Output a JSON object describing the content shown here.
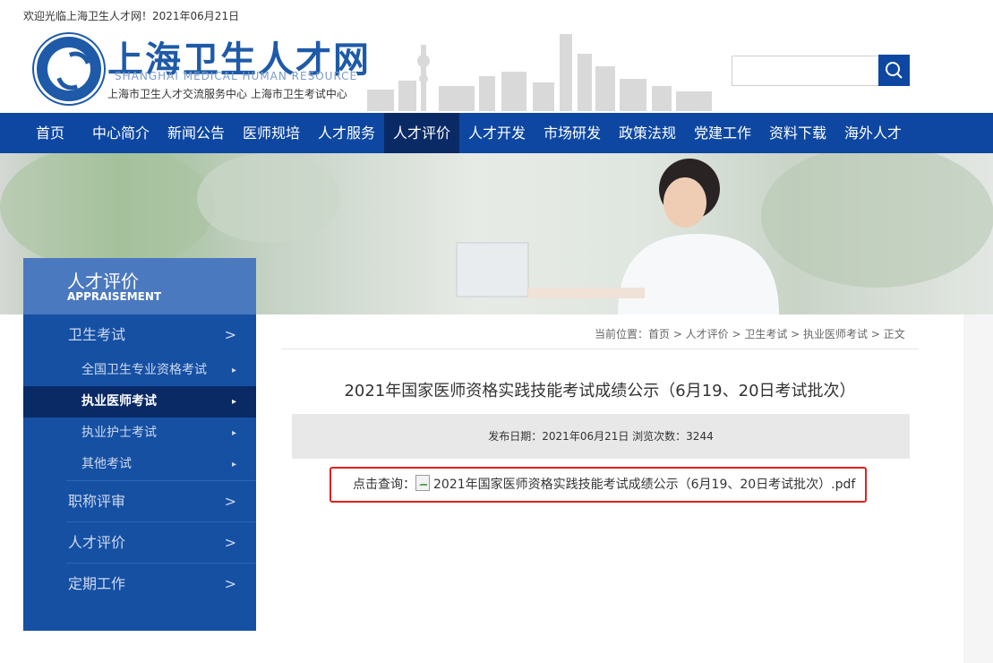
{
  "topbar": {
    "welcome": "欢迎光临上海卫生人才网！2021年06月21日"
  },
  "header": {
    "site_title": "上海卫生人才网",
    "site_en": "SHANGHAI MEDICAL HUMAN RESOURCE",
    "site_sub": "上海市卫生人才交流服务中心   上海市卫生考试中心",
    "search": {
      "placeholder": ""
    }
  },
  "nav": {
    "items": [
      "首页",
      "中心简介",
      "新闻公告",
      "医师规培",
      "人才服务",
      "人才评价",
      "人才开发",
      "市场研发",
      "政策法规",
      "党建工作",
      "资料下载",
      "海外人才"
    ],
    "active": "人才评价"
  },
  "sidebar": {
    "title": "人才评价",
    "title_en": "APPRAISEMENT",
    "items": [
      {
        "label": "卫生考试",
        "arrow": ">",
        "subitems": [
          {
            "label": "全国卫生专业资格考试",
            "arrow": "▸"
          },
          {
            "label": "执业医师考试",
            "arrow": "▸",
            "active": true
          },
          {
            "label": "执业护士考试",
            "arrow": "▸"
          },
          {
            "label": "其他考试",
            "arrow": "▸"
          }
        ]
      },
      {
        "label": "职称评审",
        "arrow": ">"
      },
      {
        "label": "人才评价",
        "arrow": ">"
      },
      {
        "label": "定期工作",
        "arrow": ">"
      }
    ]
  },
  "breadcrumb": {
    "text": "当前位置：首页  >  人才评价  >  卫生考试  >  执业医师考试  >  正文"
  },
  "article": {
    "title": "2021年国家医师资格实践技能考试成绩公示（6月19、20日考试批次）",
    "meta": "发布日期：2021年06月21日    浏览次数：3244",
    "query_label": "点击查询：",
    "file_link": "2021年国家医师资格实践技能考试成绩公示（6月19、20日考试批次）.pdf"
  },
  "colors": {
    "brand_blue": "#0d47a1",
    "nav_active": "#0a2a66",
    "sidebar_blue": "#1550a3",
    "highlight_red": "#e02020"
  }
}
